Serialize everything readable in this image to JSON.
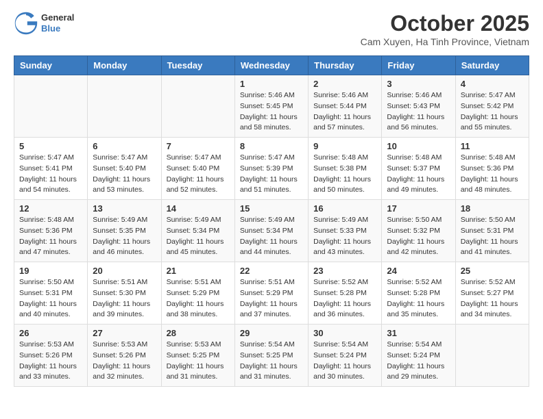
{
  "header": {
    "logo": {
      "general": "General",
      "blue": "Blue"
    },
    "title": "October 2025",
    "location": "Cam Xuyen, Ha Tinh Province, Vietnam"
  },
  "days_of_week": [
    "Sunday",
    "Monday",
    "Tuesday",
    "Wednesday",
    "Thursday",
    "Friday",
    "Saturday"
  ],
  "weeks": [
    [
      {
        "day": "",
        "info": ""
      },
      {
        "day": "",
        "info": ""
      },
      {
        "day": "",
        "info": ""
      },
      {
        "day": "1",
        "info": "Sunrise: 5:46 AM\nSunset: 5:45 PM\nDaylight: 11 hours\nand 58 minutes."
      },
      {
        "day": "2",
        "info": "Sunrise: 5:46 AM\nSunset: 5:44 PM\nDaylight: 11 hours\nand 57 minutes."
      },
      {
        "day": "3",
        "info": "Sunrise: 5:46 AM\nSunset: 5:43 PM\nDaylight: 11 hours\nand 56 minutes."
      },
      {
        "day": "4",
        "info": "Sunrise: 5:47 AM\nSunset: 5:42 PM\nDaylight: 11 hours\nand 55 minutes."
      }
    ],
    [
      {
        "day": "5",
        "info": "Sunrise: 5:47 AM\nSunset: 5:41 PM\nDaylight: 11 hours\nand 54 minutes."
      },
      {
        "day": "6",
        "info": "Sunrise: 5:47 AM\nSunset: 5:40 PM\nDaylight: 11 hours\nand 53 minutes."
      },
      {
        "day": "7",
        "info": "Sunrise: 5:47 AM\nSunset: 5:40 PM\nDaylight: 11 hours\nand 52 minutes."
      },
      {
        "day": "8",
        "info": "Sunrise: 5:47 AM\nSunset: 5:39 PM\nDaylight: 11 hours\nand 51 minutes."
      },
      {
        "day": "9",
        "info": "Sunrise: 5:48 AM\nSunset: 5:38 PM\nDaylight: 11 hours\nand 50 minutes."
      },
      {
        "day": "10",
        "info": "Sunrise: 5:48 AM\nSunset: 5:37 PM\nDaylight: 11 hours\nand 49 minutes."
      },
      {
        "day": "11",
        "info": "Sunrise: 5:48 AM\nSunset: 5:36 PM\nDaylight: 11 hours\nand 48 minutes."
      }
    ],
    [
      {
        "day": "12",
        "info": "Sunrise: 5:48 AM\nSunset: 5:36 PM\nDaylight: 11 hours\nand 47 minutes."
      },
      {
        "day": "13",
        "info": "Sunrise: 5:49 AM\nSunset: 5:35 PM\nDaylight: 11 hours\nand 46 minutes."
      },
      {
        "day": "14",
        "info": "Sunrise: 5:49 AM\nSunset: 5:34 PM\nDaylight: 11 hours\nand 45 minutes."
      },
      {
        "day": "15",
        "info": "Sunrise: 5:49 AM\nSunset: 5:34 PM\nDaylight: 11 hours\nand 44 minutes."
      },
      {
        "day": "16",
        "info": "Sunrise: 5:49 AM\nSunset: 5:33 PM\nDaylight: 11 hours\nand 43 minutes."
      },
      {
        "day": "17",
        "info": "Sunrise: 5:50 AM\nSunset: 5:32 PM\nDaylight: 11 hours\nand 42 minutes."
      },
      {
        "day": "18",
        "info": "Sunrise: 5:50 AM\nSunset: 5:31 PM\nDaylight: 11 hours\nand 41 minutes."
      }
    ],
    [
      {
        "day": "19",
        "info": "Sunrise: 5:50 AM\nSunset: 5:31 PM\nDaylight: 11 hours\nand 40 minutes."
      },
      {
        "day": "20",
        "info": "Sunrise: 5:51 AM\nSunset: 5:30 PM\nDaylight: 11 hours\nand 39 minutes."
      },
      {
        "day": "21",
        "info": "Sunrise: 5:51 AM\nSunset: 5:29 PM\nDaylight: 11 hours\nand 38 minutes."
      },
      {
        "day": "22",
        "info": "Sunrise: 5:51 AM\nSunset: 5:29 PM\nDaylight: 11 hours\nand 37 minutes."
      },
      {
        "day": "23",
        "info": "Sunrise: 5:52 AM\nSunset: 5:28 PM\nDaylight: 11 hours\nand 36 minutes."
      },
      {
        "day": "24",
        "info": "Sunrise: 5:52 AM\nSunset: 5:28 PM\nDaylight: 11 hours\nand 35 minutes."
      },
      {
        "day": "25",
        "info": "Sunrise: 5:52 AM\nSunset: 5:27 PM\nDaylight: 11 hours\nand 34 minutes."
      }
    ],
    [
      {
        "day": "26",
        "info": "Sunrise: 5:53 AM\nSunset: 5:26 PM\nDaylight: 11 hours\nand 33 minutes."
      },
      {
        "day": "27",
        "info": "Sunrise: 5:53 AM\nSunset: 5:26 PM\nDaylight: 11 hours\nand 32 minutes."
      },
      {
        "day": "28",
        "info": "Sunrise: 5:53 AM\nSunset: 5:25 PM\nDaylight: 11 hours\nand 31 minutes."
      },
      {
        "day": "29",
        "info": "Sunrise: 5:54 AM\nSunset: 5:25 PM\nDaylight: 11 hours\nand 31 minutes."
      },
      {
        "day": "30",
        "info": "Sunrise: 5:54 AM\nSunset: 5:24 PM\nDaylight: 11 hours\nand 30 minutes."
      },
      {
        "day": "31",
        "info": "Sunrise: 5:54 AM\nSunset: 5:24 PM\nDaylight: 11 hours\nand 29 minutes."
      },
      {
        "day": "",
        "info": ""
      }
    ]
  ]
}
